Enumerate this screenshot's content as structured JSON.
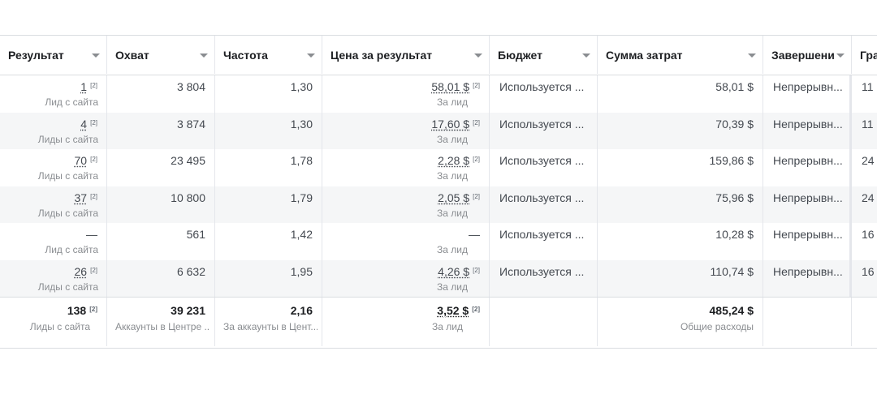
{
  "headers": [
    "Результат",
    "Охват",
    "Частота",
    "Цена за результат",
    "Бюджет",
    "Сумма затрат",
    "Завершение",
    "Гра"
  ],
  "rows": [
    {
      "result": "1",
      "result_sub": "Лид с сайта",
      "reach": "3 804",
      "freq": "1,30",
      "cpr": "58,01 $",
      "cpr_sub": "За лид",
      "budget": "Используется ...",
      "spent": "58,01 $",
      "end": "Непрерывн...",
      "gr": "11"
    },
    {
      "result": "4",
      "result_sub": "Лиды с сайта",
      "reach": "3 874",
      "freq": "1,30",
      "cpr": "17,60 $",
      "cpr_sub": "За лид",
      "budget": "Используется ...",
      "spent": "70,39 $",
      "end": "Непрерывн...",
      "gr": "11"
    },
    {
      "result": "70",
      "result_sub": "Лиды с сайта",
      "reach": "23 495",
      "freq": "1,78",
      "cpr": "2,28 $",
      "cpr_sub": "За лид",
      "budget": "Используется ...",
      "spent": "159,86 $",
      "end": "Непрерывн...",
      "gr": "24"
    },
    {
      "result": "37",
      "result_sub": "Лиды с сайта",
      "reach": "10 800",
      "freq": "1,79",
      "cpr": "2,05 $",
      "cpr_sub": "За лид",
      "budget": "Используется ...",
      "spent": "75,96 $",
      "end": "Непрерывн...",
      "gr": "24"
    },
    {
      "result": "—",
      "result_sub": "Лид с сайта",
      "reach": "561",
      "freq": "1,42",
      "cpr": "—",
      "cpr_sub": "За лид",
      "budget": "Используется ...",
      "spent": "10,28 $",
      "end": "Непрерывн...",
      "gr": "16"
    },
    {
      "result": "26",
      "result_sub": "Лиды с сайта",
      "reach": "6 632",
      "freq": "1,95",
      "cpr": "4,26 $",
      "cpr_sub": "За лид",
      "budget": "Используется ...",
      "spent": "110,74 $",
      "end": "Непрерывн...",
      "gr": "16"
    }
  ],
  "footnote": "[2]",
  "totals": {
    "result": "138",
    "result_sub": "Лиды с сайта",
    "reach": "39 231",
    "reach_sub": "Аккаунты в Центре ...",
    "freq": "2,16",
    "freq_sub": "За аккаунты в Цент...",
    "cpr": "3,52 $",
    "cpr_sub": "За лид",
    "spent": "485,24 $",
    "spent_sub": "Общие расходы"
  }
}
